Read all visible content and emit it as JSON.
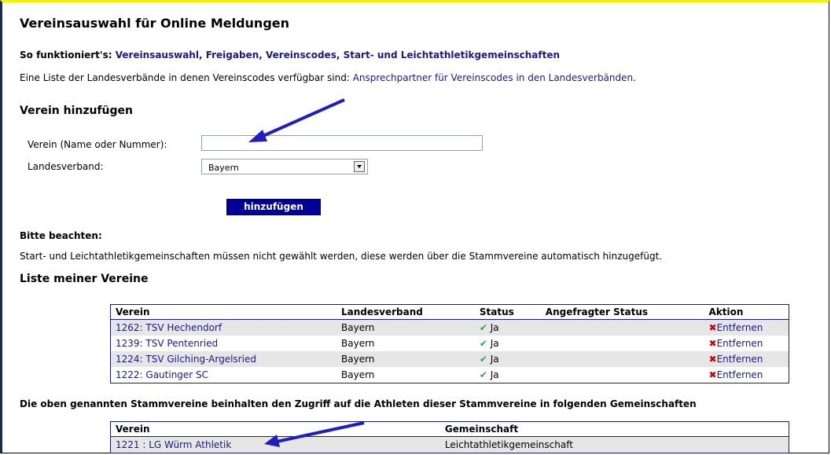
{
  "page": {
    "title": "Vereinsauswahl für Online Meldungen",
    "howto_prefix": "So funktioniert's:",
    "howto_links": "Vereinsauswahl, Freigaben, Vereinscodes, Start- und Leichtathletikgemeinschaften",
    "list_prefix": "Eine Liste der Landesverbände in denen Vereinscodes verfügbar sind:",
    "list_link": "Ansprechpartner für Vereinscodes in den Landesverbänden",
    "list_suffix": "."
  },
  "add_section": {
    "heading": "Verein hinzufügen",
    "verein_label": "Verein (Name oder Nummer):",
    "verein_value": "",
    "landesverband_label": "Landesverband:",
    "landesverband_value": "Bayern",
    "add_button": "hinzufügen"
  },
  "notice": {
    "heading": "Bitte beachten:",
    "text": "Start- und Leichtathletikgemeinschaften müssen nicht gewählt werden, diese werden über die Stammvereine automatisch hinzugefügt."
  },
  "my_clubs": {
    "heading": "Liste meiner Vereine",
    "columns": [
      "Verein",
      "Landesverband",
      "Status",
      "Angefragter Status",
      "Aktion"
    ],
    "rows": [
      {
        "verein": "1262: TSV Hechendorf",
        "landesverband": "Bayern",
        "status": "Ja",
        "requested": "",
        "action": "Entfernen"
      },
      {
        "verein": "1239: TSV Pentenried",
        "landesverband": "Bayern",
        "status": "Ja",
        "requested": "",
        "action": "Entfernen"
      },
      {
        "verein": "1224: TSV Gilching-Argelsried",
        "landesverband": "Bayern",
        "status": "Ja",
        "requested": "",
        "action": "Entfernen"
      },
      {
        "verein": "1222: Gautinger SC",
        "landesverband": "Bayern",
        "status": "Ja",
        "requested": "",
        "action": "Entfernen"
      }
    ]
  },
  "communities": {
    "heading": "Die oben genannten Stammvereine beinhalten den Zugriff auf die Athleten dieser Stammvereine in folgenden Gemeinschaften",
    "columns": [
      "Verein",
      "Gemeinschaft"
    ],
    "rows": [
      {
        "verein": "1221 : LG Würm Athletik",
        "gemeinschaft": "Leichtathletikgemeinschaft"
      }
    ]
  },
  "icons": {
    "status_ok": "check-icon",
    "remove": "x-icon",
    "annotation": "arrow-icon"
  },
  "colors": {
    "link": "#1a1a8c",
    "button": "#000099",
    "check": "#3aa23a",
    "remove": "#d40000",
    "arrow": "#1f1fbf"
  }
}
